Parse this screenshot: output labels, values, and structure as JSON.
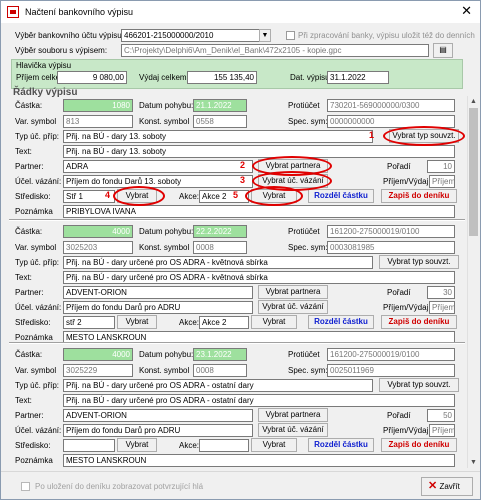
{
  "window": {
    "title": "Načtení bankovního výpisu",
    "close": "✕"
  },
  "top": {
    "account_label": "Výběr bankovního účtu výpisu",
    "account_value": "466201-215000000/2010",
    "file_label": "Výběr souboru s výpisem:",
    "file_value": "C:\\Projekty\\Delphi6\\Am_Denik\\el_Bank\\472x2105 - kopie.gpc",
    "copy_checkbox_label": "Při zpracování banky, výpisu uložit též do denních"
  },
  "header": {
    "legend": "Hlavička výpisu",
    "incoming_label": "Příjem celkem",
    "incoming_value": "9 080,00",
    "outgoing_label": "Výdaj celkem:",
    "outgoing_value": "155 135,40",
    "date_label": "Dat. výpisu:",
    "date_value": "31.1.2022"
  },
  "rows_legend": "Řádky výpisu",
  "labels": {
    "amount": "Částka:",
    "move_date": "Datum pohybu:",
    "counter_account": "Protiúčet",
    "var_symbol": "Var. symbol",
    "const_symbol": "Konst. symbol",
    "spec_symbol": "Spec. sym:",
    "type": "Typ úč. příp:",
    "text": "Text:",
    "partner": "Partner:",
    "order": "Pořadí",
    "purpose": "Účel. vázání:",
    "inc_exp": "Příjem/Výdaj",
    "center": "Středisko:",
    "action": "Akce:",
    "note": "Poznámka",
    "choose_type": "Vybrat typ souvzt.",
    "choose_partner": "Vybrat partnera",
    "choose_purpose": "Vybrat úč. vázání",
    "choose": "Vybrat",
    "split": "Rozděl částku",
    "write": "Zapiš do deníku",
    "inc_exp_placeholder": "Příjem"
  },
  "records": [
    {
      "amount": "1080",
      "date": "21.1.2022",
      "counter": "730201-569000000/0300",
      "vs": "813",
      "ks": "0558",
      "ss": "0000000000",
      "type": "Přij. na BÚ - dary 13. soboty",
      "text": "Přij. na BÚ - dary 13. soboty",
      "partner": "ADRA",
      "order": "10",
      "purpose": "Příjem do fondu Darů 13. soboty",
      "center": "Stř 1",
      "action": "Akce 2",
      "note": "PRIBYLOVA IVANA"
    },
    {
      "amount": "4000",
      "date": "22.2.2022",
      "counter": "161200-275000019/0100",
      "vs": "3025203",
      "ks": "0008",
      "ss": "0003081985",
      "type": "Přij. na BÚ - dary určené pro OS ADRA - květnová sbírka",
      "text": "Přij. na BÚ - dary určené pro OS ADRA - květnová sbírka",
      "partner": "ADVENT-ORION",
      "order": "30",
      "purpose": "Příjem do fondu Darů pro ADRU",
      "center": "stř 2",
      "action": "Akce 2",
      "note": "MESTO LANSKROUN"
    },
    {
      "amount": "4000",
      "date": "23.1.2022",
      "counter": "161200-275000019/0100",
      "vs": "3025229",
      "ks": "0008",
      "ss": "0025011969",
      "type": "Přij. na BÚ - dary určené pro OS ADRA - ostatní dary",
      "text": "Přij. na BÚ - dary určené pro OS ADRA - ostatní dary",
      "partner": "ADVENT-ORION",
      "order": "50",
      "purpose": "Příjem do fondu Darů pro ADRU",
      "center": "",
      "action": "",
      "note": "MESTO LANSKROUN"
    }
  ],
  "annotations": [
    "1",
    "2",
    "3",
    "4",
    "5"
  ],
  "footer": {
    "confirm_label": "Po uložení do deníku zobrazovat potvrzující hlá",
    "close_label": "Zavřít",
    "close_icon": "red-x-icon"
  }
}
